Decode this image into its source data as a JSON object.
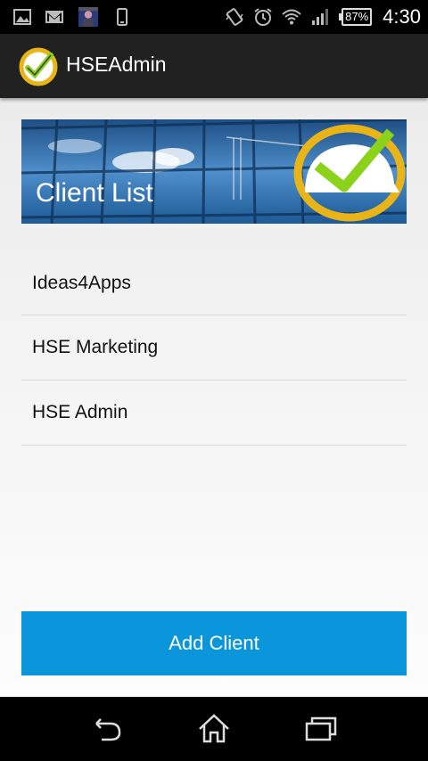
{
  "status_bar": {
    "left_icons": [
      "image-icon",
      "gmail-icon",
      "avatar-icon",
      "phone-icon"
    ],
    "right_icons": [
      "vibrate-icon",
      "alarm-icon",
      "wifi-icon",
      "signal-icon"
    ],
    "battery": "87%",
    "time": "4:30"
  },
  "action_bar": {
    "title": "HSEAdmin"
  },
  "banner": {
    "title": "Client List"
  },
  "clients": [
    "Ideas4Apps",
    "HSE Marketing",
    "HSE Admin"
  ],
  "add_button": {
    "label": "Add Client"
  },
  "colors": {
    "accent": "#0b96dc",
    "action_bar": "#212121",
    "logo_ring": "#e8b418",
    "logo_check": "#8bd21a"
  },
  "nav_bar": {
    "buttons": [
      "back-icon",
      "home-icon",
      "recent-apps-icon"
    ]
  }
}
